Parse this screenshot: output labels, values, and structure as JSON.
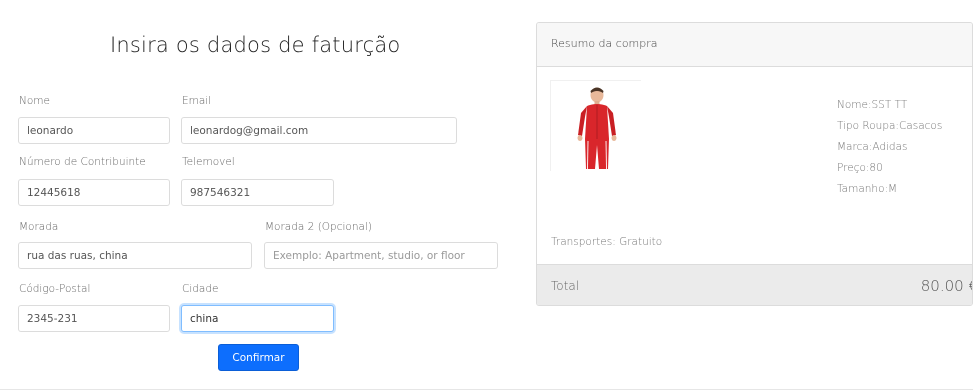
{
  "form": {
    "title": "Insira os dados de faturção",
    "fields": {
      "nome": {
        "label": "Nome",
        "value": "leonardo"
      },
      "email": {
        "label": "Email",
        "value": "leonardog@gmail.com"
      },
      "contribuinte": {
        "label": "Número de Contribuinte",
        "value": "12445618"
      },
      "telemovel": {
        "label": "Telemovel",
        "value": "987546321"
      },
      "morada": {
        "label": "Morada",
        "value": "rua das ruas, china"
      },
      "morada2": {
        "label": "Morada 2 (Opcional)",
        "value": "",
        "placeholder": "Exemplo: Apartment, studio, or floor"
      },
      "codigo_postal": {
        "label": "Código-Postal",
        "value": "2345-231"
      },
      "cidade": {
        "label": "Cidade",
        "value": "china"
      }
    },
    "confirm_label": "Confirmar"
  },
  "summary": {
    "title": "Resumo da compra",
    "product": {
      "image_icon": "red-tracksuit-product-photo",
      "nome": "Nome:SST TT",
      "tipo": "Tipo Roupa:Casacos",
      "marca": "Marca:Adidas",
      "preco": "Preço:80",
      "tamanho": "Tamanho:M"
    },
    "transport": "Transportes: Gratuito",
    "total_label": "Total",
    "total_value": "80.00 €"
  },
  "colors": {
    "accent": "#0d6efd",
    "jacket_red": "#d9262b"
  }
}
